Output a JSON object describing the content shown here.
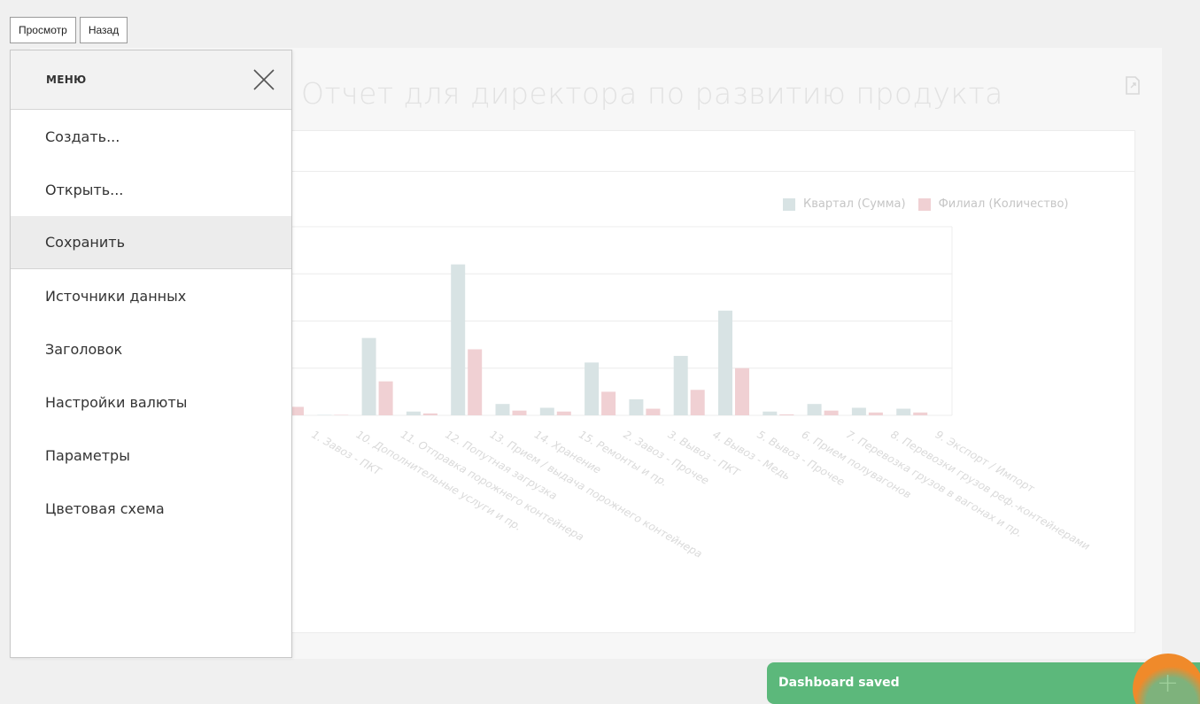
{
  "toolbar": {
    "view_label": "Просмотр",
    "back_label": "Назад"
  },
  "dashboard": {
    "title": "Отчет для директора по развитию продукта"
  },
  "menu": {
    "title": "МЕНЮ",
    "items": [
      {
        "label": "Создать..."
      },
      {
        "label": "Открыть..."
      },
      {
        "label": "Сохранить",
        "active": true
      },
      {
        "label": "Источники данных"
      },
      {
        "label": "Заголовок"
      },
      {
        "label": "Настройки валюты"
      },
      {
        "label": "Параметры"
      },
      {
        "label": "Цветовая схема"
      }
    ]
  },
  "colors": {
    "series1": "#d8e3e4",
    "series2": "#f0d0d3",
    "toast": "#5cb87b",
    "fab": "#f08a2a"
  },
  "chart_data": {
    "type": "bar",
    "categories": [
      "1. Завоз - ПКТ",
      "10. Дополнительные услуги и пр.",
      "11. Отправка порожнего контейнера",
      "12. Попутная загрузка",
      "13. Прием / выдача порожнего контейнера",
      "14. Хранение",
      "15. Ремонты и пр.",
      "2. Завоз - Прочее",
      "3. Вывоз - ПКТ",
      "4. Вывоз - Медь",
      "5. Вывоз - Прочее",
      "6. Прием полувагонов",
      "7. Перевозка грузов в вагонах и пр.",
      "8. Перевозки грузов реф.-контейнерами",
      "9. Экспорт / Импорт"
    ],
    "series": [
      {
        "name": "Квартал (Сумма)",
        "values": [
          46,
          1,
          164,
          8,
          320,
          24,
          16,
          112,
          34,
          126,
          222,
          8,
          24,
          16,
          14
        ]
      },
      {
        "name": "Филиал (Количество)",
        "values": [
          18,
          1,
          72,
          4,
          140,
          10,
          8,
          50,
          14,
          54,
          100,
          2,
          10,
          6,
          6
        ]
      }
    ],
    "xlabel": "",
    "ylabel": "",
    "ylim": [
      0,
      400
    ],
    "grid": true,
    "legend": "top-right"
  },
  "toast": {
    "message": "Dashboard saved"
  },
  "fab": {
    "label": "+"
  }
}
